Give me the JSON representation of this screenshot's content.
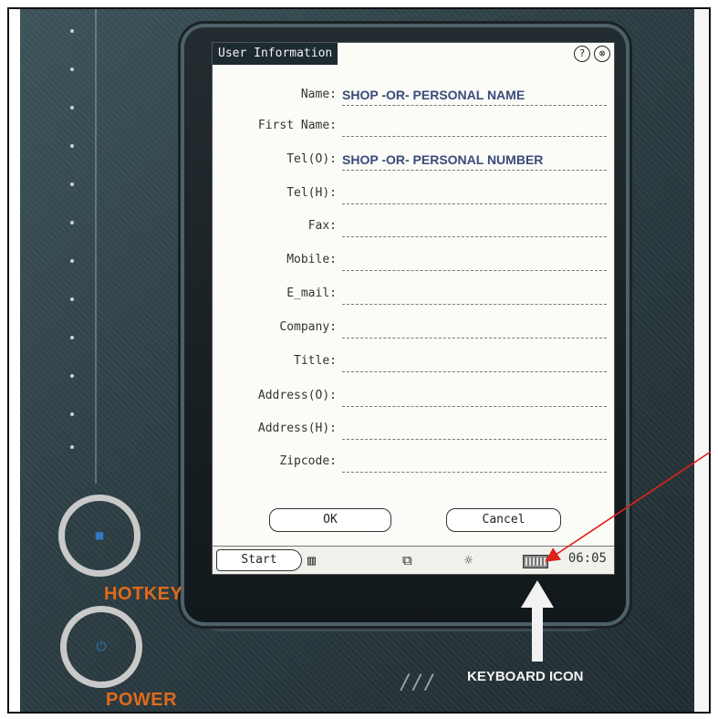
{
  "window": {
    "title": "User Information",
    "help_icon": "?",
    "close_icon": "⊗"
  },
  "form": {
    "fields": [
      {
        "label": "Name:",
        "value": "SHOP -OR- PERSONAL NAME"
      },
      {
        "label": "First Name:",
        "value": ""
      },
      {
        "label": "Tel(O):",
        "value": "SHOP -OR- PERSONAL NUMBER"
      },
      {
        "label": "Tel(H):",
        "value": ""
      },
      {
        "label": "Fax:",
        "value": ""
      },
      {
        "label": "Mobile:",
        "value": ""
      },
      {
        "label": "E_mail:",
        "value": ""
      },
      {
        "label": "Company:",
        "value": ""
      },
      {
        "label": "Title:",
        "value": ""
      },
      {
        "label": "Address(O):",
        "value": ""
      },
      {
        "label": "Address(H):",
        "value": ""
      },
      {
        "label": "Zipcode:",
        "value": ""
      }
    ],
    "ok_label": "OK",
    "cancel_label": "Cancel"
  },
  "taskbar": {
    "start_label": "Start",
    "time": "06:05"
  },
  "device": {
    "hotkey_label": "HOTKEY",
    "power_label": "POWER"
  },
  "annotation": {
    "keyboard_label": "KEYBOARD ICON",
    "arrow_color": "#e0201a"
  },
  "colors": {
    "accent_orange": "#e06a1a",
    "value_blue": "#3a4a7a",
    "title_bg": "#1d2b31"
  }
}
